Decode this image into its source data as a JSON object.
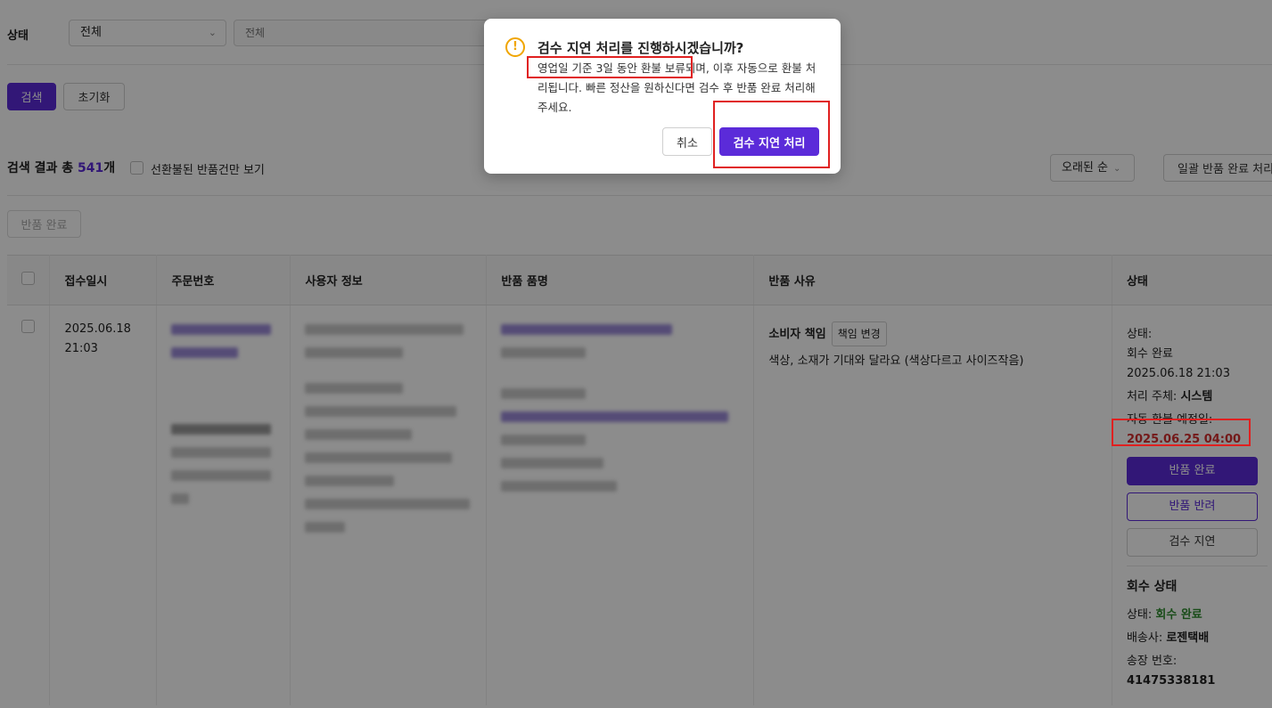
{
  "filter": {
    "status_label": "상태",
    "status_value": "전체",
    "keyword_placeholder": "전체",
    "search_label": "검색",
    "reset_label": "초기화"
  },
  "results": {
    "prefix": "검색 결과 총 ",
    "count": "541",
    "suffix": "개",
    "only_unconverted_label": "선환불된 반품건만 보기",
    "sort_value": "오래된 순",
    "bulk_complete_label": "일괄 반품 완료 처리",
    "return_complete_label": "반품 완료"
  },
  "table": {
    "headers": [
      "접수일시",
      "주문번호",
      "사용자 정보",
      "반품 품명",
      "반품 사유",
      "상태"
    ],
    "row": {
      "date": "2025.06.18",
      "time": "21:03",
      "reason_type": "소비자 책임",
      "reason_change_label": "책임 변경",
      "reason_text": "색상, 소재가 기대와 달라요 (색상다르고 사이즈작음)",
      "status_title": "상태:",
      "status_value": "회수 완료",
      "status_date": "2025.06.18 21:03",
      "handler_label": "처리 주체:",
      "handler_value": "시스템",
      "auto_refund_label": "자동 환불 예정일:",
      "auto_refund_date": "2025.06.25 04:00",
      "btn_complete": "반품 완료",
      "btn_reject": "반품 반려",
      "btn_delay": "검수 지연",
      "pickup_title": "회수 상태",
      "pickup_status_label": "상태:",
      "pickup_status_value": "회수 완료",
      "courier_label": "배송사:",
      "courier_value": "로젠택배",
      "invoice_label": "송장 번호:",
      "invoice_value": "41475338181"
    }
  },
  "modal": {
    "icon": "exclamation-icon",
    "title": "검수 지연 처리를 진행하시겠습니까?",
    "body": "영업일 기준 3일 동안 환불 보류되며, 이후 자동으로 환불 처리됩니다. 빠른 정산을 원하신다면 검수 후 반품 완료 처리해주세요.",
    "cancel_label": "취소",
    "confirm_label": "검수 지연 처리"
  },
  "colors": {
    "accent": "#5b2bd9",
    "warning": "#f0a500",
    "highlight": "#e02020",
    "danger_text": "#d32f2f",
    "success_text": "#2e8b2e"
  }
}
